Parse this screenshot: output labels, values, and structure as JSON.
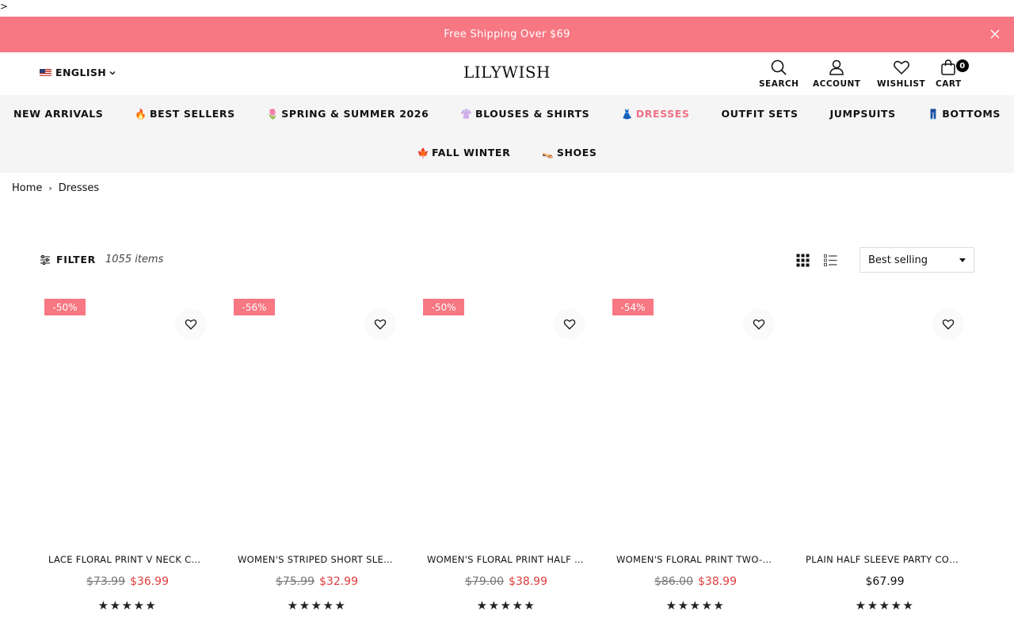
{
  "stray_char": ">",
  "announcement": {
    "text": "Free Shipping Over $69"
  },
  "header": {
    "language": "ENGLISH",
    "logo": "LILYWISH",
    "search_label": "SEARCH",
    "account_label": "ACCOUNT",
    "wishlist_label": "WISHLIST",
    "cart_label": "CART",
    "cart_count": "0"
  },
  "nav": {
    "items": [
      {
        "label": "NEW ARRIVALS",
        "emoji": ""
      },
      {
        "label": "BEST SELLERS",
        "emoji": "🔥"
      },
      {
        "label": "SPRING & SUMMER 2026",
        "emoji": "🌷"
      },
      {
        "label": "BLOUSES & SHIRTS",
        "emoji": "👚"
      },
      {
        "label": "DRESSES",
        "emoji": "👗"
      },
      {
        "label": "OUTFIT SETS",
        "emoji": ""
      },
      {
        "label": "JUMPSUITS",
        "emoji": ""
      },
      {
        "label": "BOTTOMS",
        "emoji": "👖"
      },
      {
        "label": "FALL WINTER",
        "emoji": "🍁"
      },
      {
        "label": "SHOES",
        "emoji": "👡"
      }
    ]
  },
  "breadcrumb": {
    "home": "Home",
    "sep": "›",
    "current": "Dresses"
  },
  "toolbar": {
    "filter_label": "FILTER",
    "item_count": "1055 items",
    "sort_value": "Best selling"
  },
  "products": [
    {
      "badge": "-50%",
      "name": "LACE FLORAL PRINT V NECK CASUAL DRESS",
      "old_price": "$73.99",
      "price": "$36.99",
      "stars": "★★★★★"
    },
    {
      "badge": "-56%",
      "name": "WOMEN'S STRIPED SHORT SLEEVE DRESS",
      "old_price": "$75.99",
      "price": "$32.99",
      "stars": "★★★★★"
    },
    {
      "badge": "-50%",
      "name": "WOMEN'S FLORAL PRINT HALF SLEEVE DRESS",
      "old_price": "$79.00",
      "price": "$38.99",
      "stars": "★★★★★"
    },
    {
      "badge": "-54%",
      "name": "WOMEN'S FLORAL PRINT TWO-PIECE DRESS",
      "old_price": "$86.00",
      "price": "$38.99",
      "stars": "★★★★★"
    },
    {
      "badge": "",
      "name": "PLAIN HALF SLEEVE PARTY COMFY DRESS",
      "old_price": "",
      "price": "$67.99",
      "stars": "★★★★★"
    }
  ],
  "colors": {
    "accent": "#f77783",
    "active_nav": "#ef6f86",
    "sale_price": "#e03e3e"
  }
}
